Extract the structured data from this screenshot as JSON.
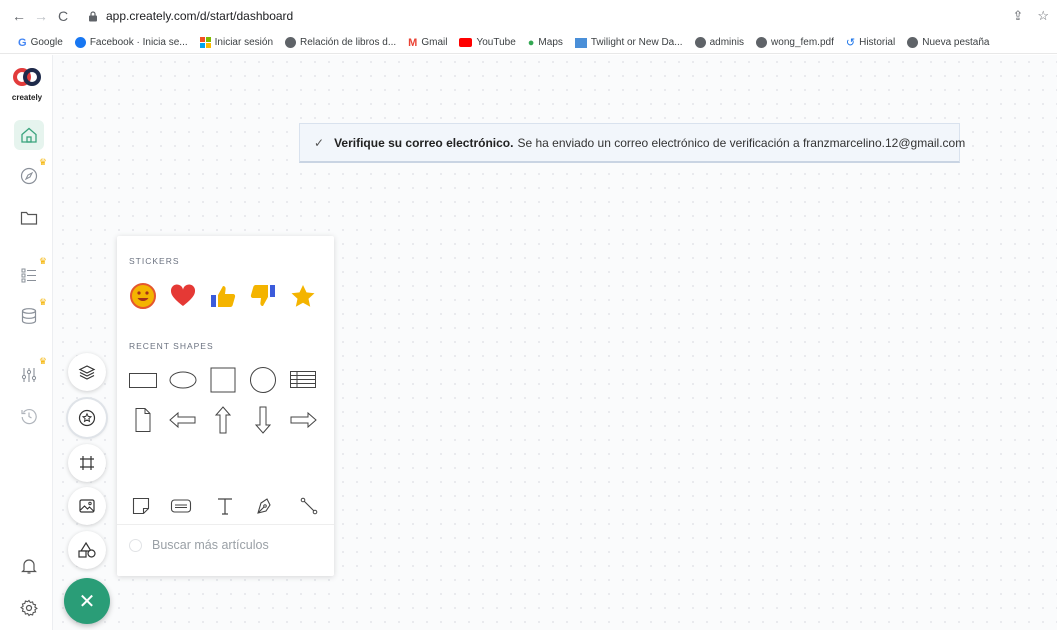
{
  "browser": {
    "url": "app.creately.com/d/start/dashboard",
    "bookmarks": [
      {
        "label": "Google",
        "color": "#4285f4"
      },
      {
        "label": "Facebook · Inicia se...",
        "color": "#1877f2"
      },
      {
        "label": "Iniciar sesión",
        "color": "#f25022"
      },
      {
        "label": "Relación de libros d...",
        "color": "#5f6368"
      },
      {
        "label": "Gmail",
        "color": "#ea4335"
      },
      {
        "label": "YouTube",
        "color": "#ff0000"
      },
      {
        "label": "Maps",
        "color": "#34a853"
      },
      {
        "label": "Twilight or New Da...",
        "color": "#4a8fd8"
      },
      {
        "label": "adminis",
        "color": "#5f6368"
      },
      {
        "label": "wong_fem.pdf",
        "color": "#5f6368"
      },
      {
        "label": "Historial",
        "color": "#1a73e8"
      },
      {
        "label": "Nueva pestaña",
        "color": "#5f6368"
      }
    ]
  },
  "app": {
    "logo_text": "creately",
    "accent": "#2a9d77",
    "sidebar_icons": [
      "home-icon",
      "compass-icon",
      "folder-icon",
      "list-icon",
      "database-icon",
      "sliders-icon",
      "history-icon",
      "bell-icon",
      "settings-icon"
    ]
  },
  "toast": {
    "bold": "Verifique su correo electrónico.",
    "message": "Se ha enviado un correo electrónico de verificación a franzmarcelino.12@gmail.com"
  },
  "panel": {
    "stickers_label": "STICKERS",
    "recent_label": "RECENT SHAPES",
    "search_placeholder": "Buscar más artículos"
  },
  "tools": [
    "layers-icon",
    "stickers-icon",
    "frame-icon",
    "image-icon",
    "shapes-icon"
  ]
}
